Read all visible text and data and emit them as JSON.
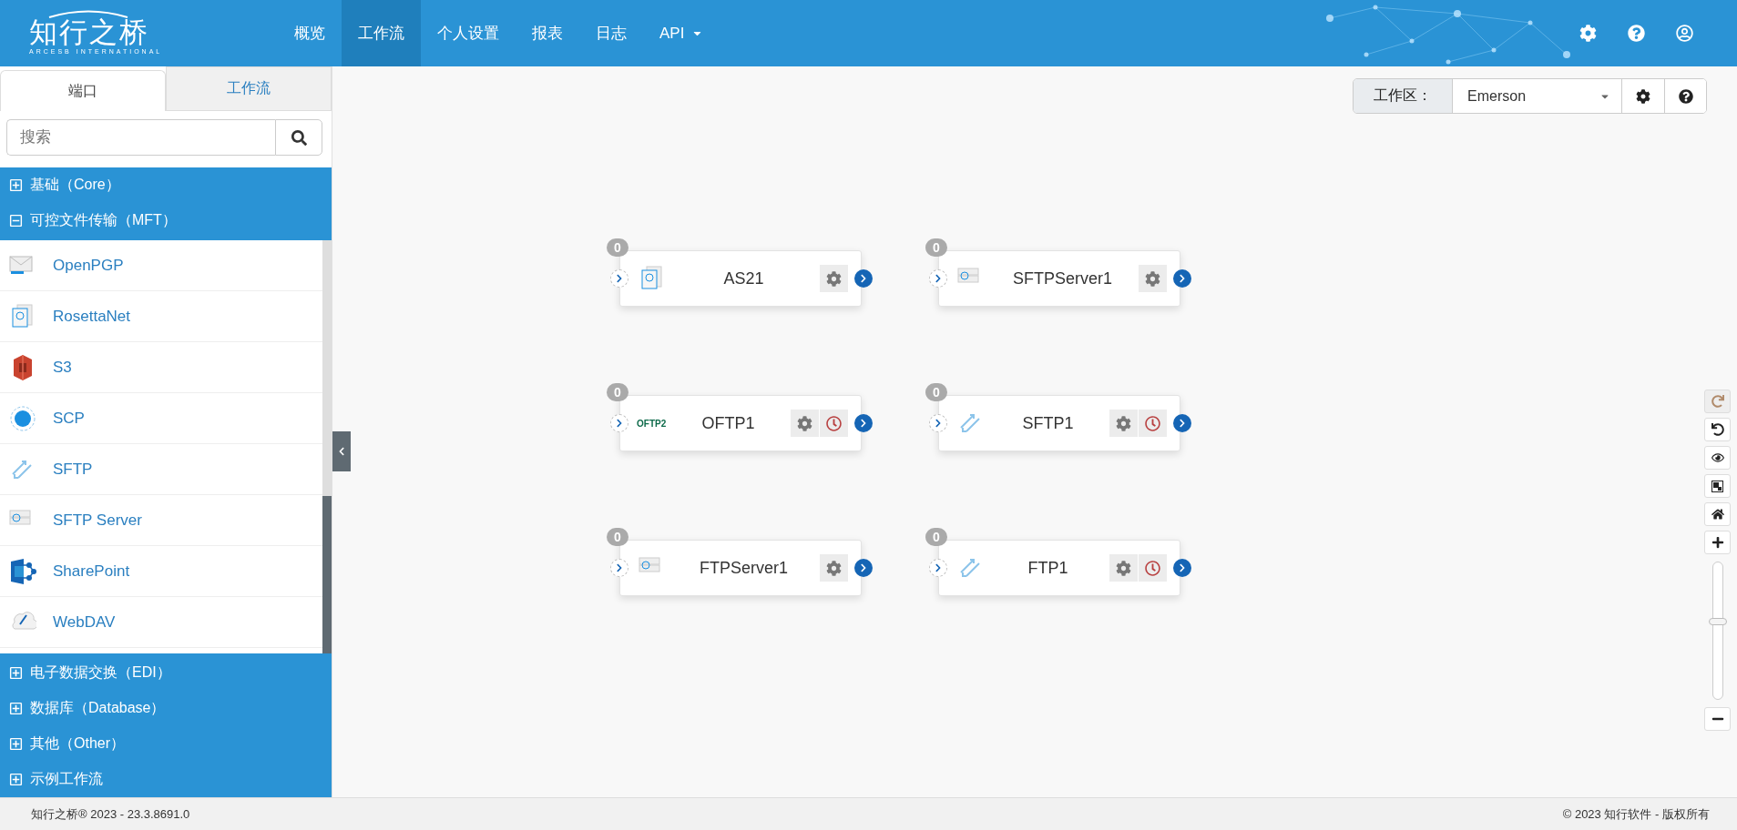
{
  "header": {
    "logo": {
      "title": "知行之桥",
      "subtitle": "ARCESB INTERNATIONAL"
    },
    "nav": [
      {
        "label": "概览",
        "selected": false,
        "dropdown": false
      },
      {
        "label": "工作流",
        "selected": true,
        "dropdown": false
      },
      {
        "label": "个人设置",
        "selected": false,
        "dropdown": false
      },
      {
        "label": "报表",
        "selected": false,
        "dropdown": false
      },
      {
        "label": "日志",
        "selected": false,
        "dropdown": false
      },
      {
        "label": "API",
        "selected": false,
        "dropdown": true
      }
    ]
  },
  "sidebar": {
    "tabs": [
      {
        "label": "端口",
        "selected": true
      },
      {
        "label": "工作流",
        "selected": false
      }
    ],
    "search": {
      "placeholder": "搜索"
    },
    "categories": [
      {
        "label": "基础（Core）",
        "expanded": false
      },
      {
        "label": "可控文件传输（MFT）",
        "expanded": true,
        "items": [
          {
            "label": "OpenPGP",
            "kind": "envelope"
          },
          {
            "label": "RosettaNet",
            "kind": "document"
          },
          {
            "label": "S3",
            "kind": "cube"
          },
          {
            "label": "SCP",
            "kind": "globe"
          },
          {
            "label": "SFTP",
            "kind": "arrows"
          },
          {
            "label": "SFTP Server",
            "kind": "server"
          },
          {
            "label": "SharePoint",
            "kind": "share"
          },
          {
            "label": "WebDAV",
            "kind": "cloud"
          }
        ]
      },
      {
        "label": "电子数据交换（EDI）",
        "expanded": false
      },
      {
        "label": "数据库（Database）",
        "expanded": false
      },
      {
        "label": "其他（Other）",
        "expanded": false
      },
      {
        "label": "示例工作流",
        "expanded": false
      }
    ]
  },
  "workspace": {
    "label": "工作区：",
    "value": "Emerson"
  },
  "nodes": [
    {
      "name": "AS21",
      "count": "0",
      "kind": "document",
      "scheduled": false
    },
    {
      "name": "SFTPServer1",
      "count": "0",
      "kind": "server",
      "scheduled": false
    },
    {
      "name": "OFTP1",
      "count": "0",
      "kind": "wordmark",
      "icon_tag": "OFTP2",
      "scheduled": true
    },
    {
      "name": "SFTP1",
      "count": "0",
      "kind": "arrows",
      "scheduled": true
    },
    {
      "name": "FTPServer1",
      "count": "0",
      "kind": "server",
      "scheduled": false
    },
    {
      "name": "FTP1",
      "count": "0",
      "kind": "arrows",
      "scheduled": true
    }
  ],
  "zoom_controls": {
    "redo_disabled": true,
    "level": 0.56
  },
  "footer": {
    "version": "知行之桥® 2023 - 23.3.8691.0",
    "copyright": "© 2023 知行软件 - 版权所有"
  }
}
